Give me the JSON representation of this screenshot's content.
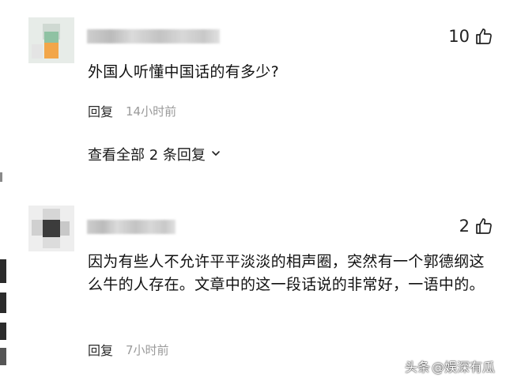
{
  "comments": [
    {
      "likes": "10",
      "text": "外国人听懂中国话的有多少?",
      "reply_label": "回复",
      "time": "14小时前",
      "expand_label": "查看全部 2 条回复"
    },
    {
      "likes": "2",
      "text": "因为有些人不允许平平淡淡的相声圈，突然有一个郭德纲这么牛的人存在。文章中的这一段话说的非常好，一语中的。",
      "reply_label": "回复",
      "time": "7小时前"
    }
  ],
  "watermark": {
    "platform": "头条",
    "account": "@娱深有瓜"
  },
  "icons": {
    "like": "thumbs-up-icon",
    "expand": "chevron-down-icon"
  },
  "colors": {
    "text": "#111111",
    "muted": "#9a9a9a",
    "avatar1_accent": "#f2a64a",
    "avatar1_base": "#7fb69a"
  }
}
